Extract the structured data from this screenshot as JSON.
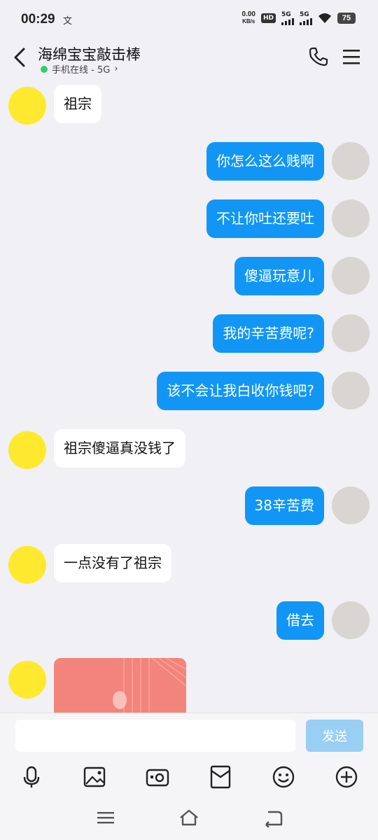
{
  "status_bar": {
    "time": "00:29",
    "extra_icon_glyph": "文",
    "net_speed_value": "0.00",
    "net_speed_unit": "KB/s",
    "hd_badge": "HD",
    "sim1_label": "5G",
    "sim2_label": "5G",
    "battery_level": "75"
  },
  "header": {
    "title": "海绵宝宝敲击棒",
    "subtitle": "手机在线 - 5G",
    "subtitle_chevron": "›",
    "online_color": "#2fce6b"
  },
  "messages": [
    {
      "side": "left",
      "text": "祖宗"
    },
    {
      "side": "right",
      "text": "你怎么这么贱啊"
    },
    {
      "side": "right",
      "text": "不让你吐还要吐"
    },
    {
      "side": "right",
      "text": "傻逼玩意儿"
    },
    {
      "side": "right",
      "text": "我的辛苦费呢?"
    },
    {
      "side": "right",
      "text": "该不会让我白收你钱吧?"
    },
    {
      "side": "left",
      "text": "祖宗傻逼真没钱了"
    },
    {
      "side": "right",
      "text": "38辛苦费"
    },
    {
      "side": "left",
      "text": "一点没有了祖宗"
    },
    {
      "side": "right",
      "text": "借去"
    },
    {
      "side": "left",
      "type": "red-packet"
    }
  ],
  "input": {
    "placeholder": "",
    "value": "",
    "send_label": "发送"
  },
  "toolbar": {
    "icons": [
      "microphone-icon",
      "image-icon",
      "camera-icon",
      "red-packet-icon",
      "emoji-icon",
      "plus-icon"
    ]
  },
  "nav": {
    "icons": [
      "menu-icon",
      "home-icon",
      "back-icon"
    ]
  },
  "colors": {
    "accent": "#1296f5",
    "background": "#f0f0f5",
    "send_disabled": "#99cff3",
    "red_packet": "#f3847b"
  }
}
